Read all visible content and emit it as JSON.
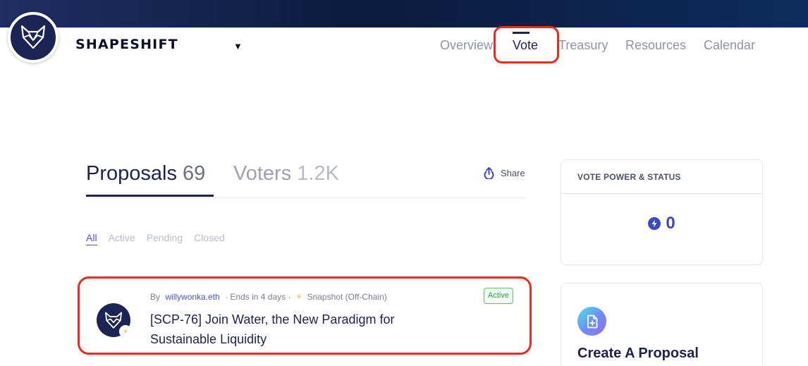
{
  "brand": {
    "name": "SHAPESHIFT",
    "caret": "▼"
  },
  "nav": {
    "items": [
      {
        "label": "Overview"
      },
      {
        "label": "Vote"
      },
      {
        "label": "Treasury"
      },
      {
        "label": "Resources"
      },
      {
        "label": "Calendar"
      }
    ],
    "active": "Vote"
  },
  "tabs": {
    "proposals": {
      "label": "Proposals",
      "count": "69"
    },
    "voters": {
      "label": "Voters",
      "count": "1.2K"
    }
  },
  "share": {
    "label": "Share",
    "icon": "share-icon"
  },
  "filters": [
    "All",
    "Active",
    "Pending",
    "Closed"
  ],
  "active_filter": "All",
  "proposal": {
    "by": "By",
    "author": "willywonka.eth",
    "ends": "· Ends in 4 days ·",
    "source": "Snapshot (Off-Chain)",
    "title": "[SCP-76] Join Water, the New Paradigm for Sustainable Liquidity",
    "status": "Active"
  },
  "vote_power": {
    "heading": "VOTE POWER & STATUS",
    "value": "0"
  },
  "create": {
    "title": "Create A Proposal"
  },
  "colors": {
    "accent": "#3d47c6",
    "highlight": "#ee2a1a",
    "navy": "#1e2250",
    "active_green": "#2f9e44"
  }
}
